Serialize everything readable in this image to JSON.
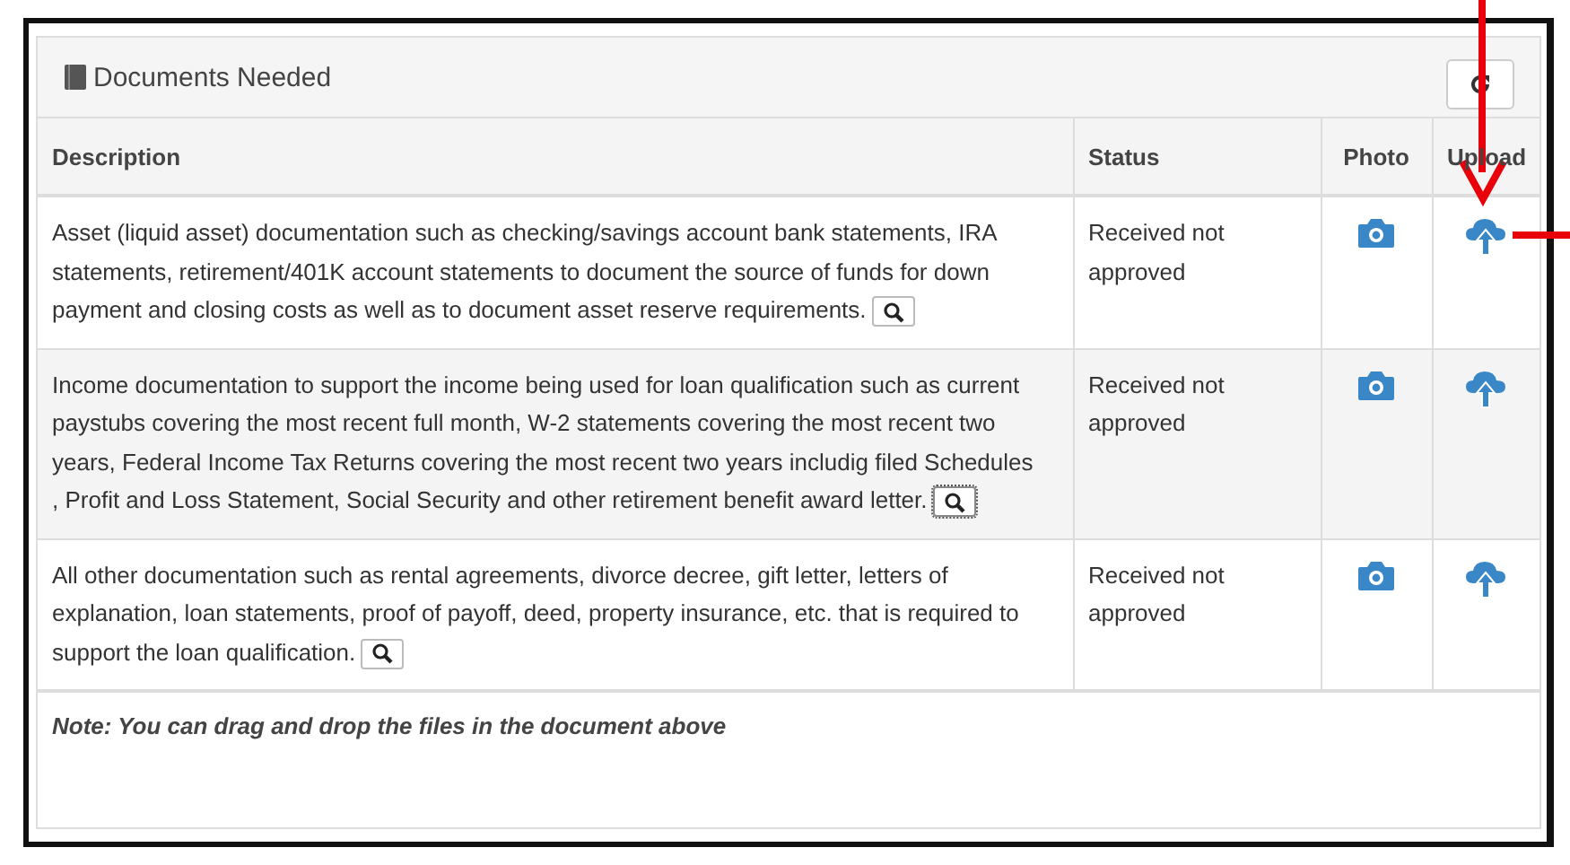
{
  "panel": {
    "title": "Documents Needed"
  },
  "table": {
    "columns": [
      "Description",
      "Status",
      "Photo",
      "Upload"
    ],
    "rows": [
      {
        "description": "Asset (liquid asset) documentation such as checking/savings account bank statements, IRA statements, retirement/401K account statements to document the source of funds for down payment and closing costs as well as to document asset reserve requirements.",
        "status": "Received not approved",
        "focused": false
      },
      {
        "description": "Income documentation to support the income being used for loan qualification such as current paystubs covering the most recent full month, W-2 statements covering the most recent two years, Federal Income Tax Returns covering the most recent two years includig filed Schedules , Profit and Loss Statement, Social Security and other retirement benefit award letter.",
        "status": "Received not approved",
        "focused": true
      },
      {
        "description": "All other documentation such as rental agreements, divorce decree, gift letter, letters of explanation, loan statements, proof of payoff, deed, property insurance, etc. that is required to support the loan qualification.",
        "status": "Received not approved",
        "focused": false
      }
    ]
  },
  "note": "Note: You can drag and drop the files in the document above"
}
